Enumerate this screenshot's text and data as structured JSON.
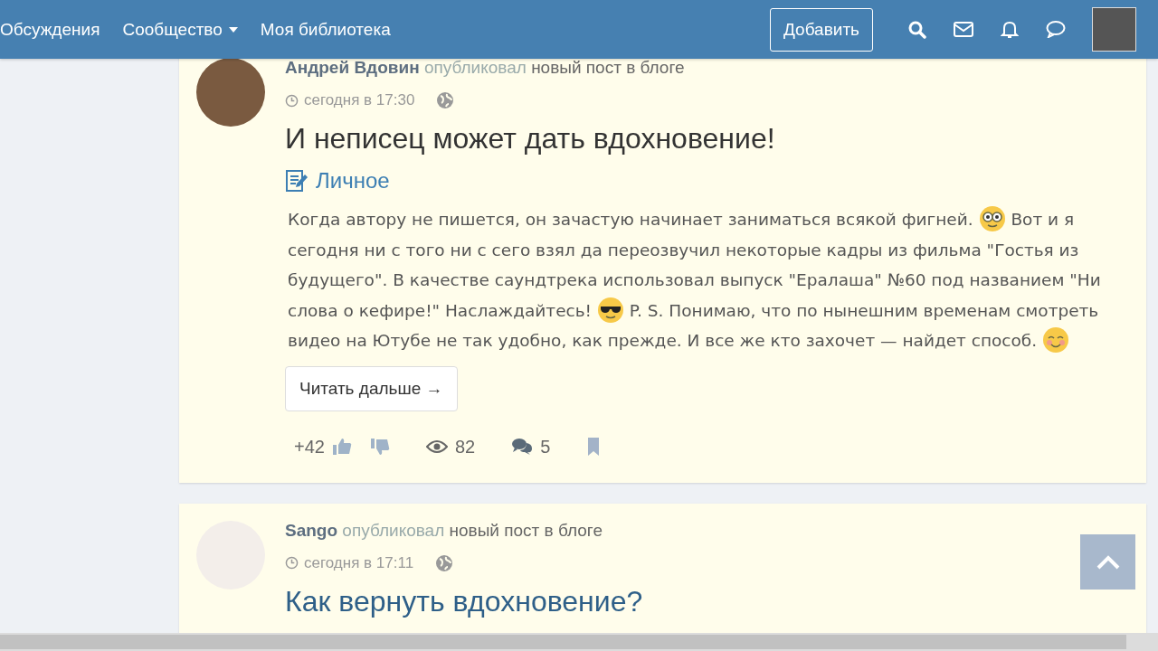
{
  "nav": {
    "items": [
      {
        "label": "Обсуждения",
        "dropdown": false
      },
      {
        "label": "Сообщество",
        "dropdown": true
      },
      {
        "label": "Моя библиотека",
        "dropdown": false
      }
    ],
    "add_button": "Добавить"
  },
  "posts": [
    {
      "author": "Андрей Вдовин",
      "action": "опубликовал",
      "object": "новый пост в блоге",
      "time": "сегодня в 17:30",
      "title": "И неписец может дать вдохновение!",
      "visited": false,
      "category": "Личное",
      "body": [
        {
          "kind": "text",
          "text": "Когда автору не пишется, он зачастую начинает заниматься всякой фигней. "
        },
        {
          "kind": "nerd"
        },
        {
          "kind": "text",
          "text": " Вот и я сегодня ни с того ни с сего взял да переозвучил некоторые кадры из фильма \"Гостья из будущего\". В качестве саундтрека использовал выпуск \"Ералаша\" №60 под названием \"Ни слова о кефире!\" Наслаждайтесь! "
        },
        {
          "kind": "cool"
        },
        {
          "kind": "text",
          "text": " P. S. Понимаю, что по нынешним временам смотреть видео на Ютубе не так удобно, как прежде. И все же кто захочет — найдет способ. "
        },
        {
          "kind": "smile"
        }
      ],
      "read_more": "Читать дальше →",
      "rating": "+42",
      "views": "82",
      "comments": "5"
    },
    {
      "author": "Sango",
      "action": "опубликовал",
      "object": "новый пост в блоге",
      "time": "сегодня в 17:11",
      "title": "Как вернуть вдохновение?",
      "visited": true
    }
  ]
}
